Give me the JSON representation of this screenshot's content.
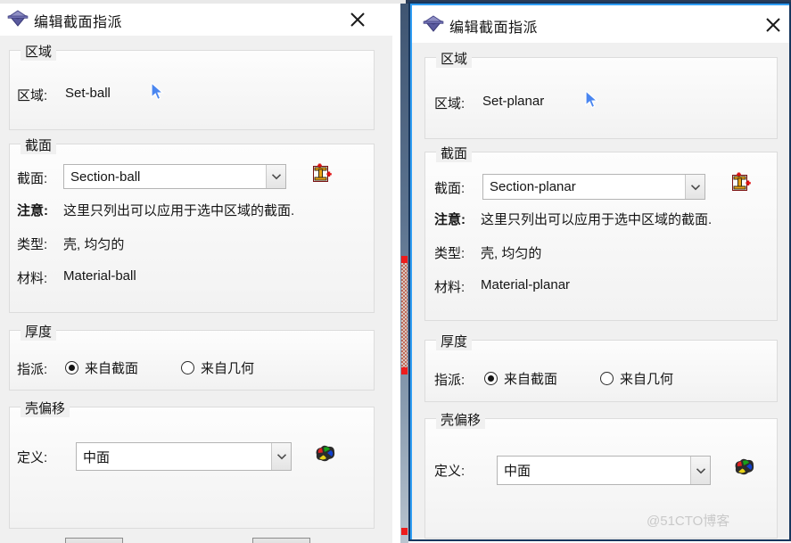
{
  "left_dialog": {
    "title": "编辑截面指派",
    "icon": "abaqus-diamond-icon",
    "close_label": "×",
    "region_group": {
      "title": "区域",
      "label": "区域:",
      "value": "Set-ball"
    },
    "section_group": {
      "title": "截面",
      "label": "截面:",
      "combo_value": "Section-ball",
      "create_icon": "create-section-icon",
      "note_label": "注意:",
      "note_value": "这里只列出可以应用于选中区域的截面.",
      "type_label": "类型:",
      "type_value": "壳, 均匀的",
      "material_label": "材料:",
      "material_value": "Material-ball"
    },
    "thickness_group": {
      "title": "厚度",
      "label": "指派:",
      "options": [
        {
          "label": "来自截面",
          "selected": true
        },
        {
          "label": "来自几何",
          "selected": false
        }
      ]
    },
    "offset_group": {
      "title": "壳偏移",
      "label": "定义:",
      "combo_value": "中面",
      "color_icon": "color-palette-icon"
    }
  },
  "right_dialog": {
    "title": "编辑截面指派",
    "icon": "abaqus-diamond-icon",
    "close_label": "×",
    "region_group": {
      "title": "区域",
      "label": "区域:",
      "value": "Set-planar"
    },
    "section_group": {
      "title": "截面",
      "label": "截面:",
      "combo_value": "Section-planar",
      "create_icon": "create-section-icon",
      "note_label": "注意:",
      "note_value": "这里只列出可以应用于选中区域的截面.",
      "type_label": "类型:",
      "type_value": "壳, 均匀的",
      "material_label": "材料:",
      "material_value": "Material-planar"
    },
    "thickness_group": {
      "title": "厚度",
      "label": "指派:",
      "options": [
        {
          "label": "来自截面",
          "selected": true
        },
        {
          "label": "来自几何",
          "selected": false
        }
      ]
    },
    "offset_group": {
      "title": "壳偏移",
      "label": "定义:",
      "combo_value": "中面",
      "color_icon": "color-palette-icon"
    }
  },
  "watermark": {
    "text": "@51CTO博客"
  },
  "colors": {
    "frame_border": "#17375e",
    "frame_accent": "#2f9ef5",
    "dialog_bg": "#f0f0f0",
    "group_border": "#dcdcdc",
    "text": "#141414",
    "cursor_blue": "#3a78e8",
    "watermark": "#c9c9c9"
  }
}
